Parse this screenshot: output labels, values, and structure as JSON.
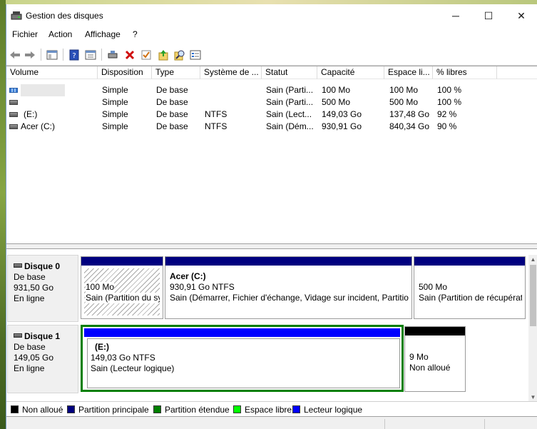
{
  "window": {
    "title": "Gestion des disques"
  },
  "titlebar": {
    "minimize": "─",
    "maximize": "☐",
    "close": "✕"
  },
  "menu": [
    "Fichier",
    "Action",
    "Affichage",
    "?"
  ],
  "toolbar": {
    "icons": [
      "back-icon",
      "forward-icon",
      "console-tree-icon",
      "help-icon",
      "properties-icon",
      "connect-icon",
      "delete-icon",
      "check-icon",
      "import-icon",
      "search-icon",
      "details-icon"
    ]
  },
  "volume_list": {
    "columns": [
      "Volume",
      "Disposition",
      "Type",
      "Système de ...",
      "Statut",
      "Capacité",
      "Espace li...",
      "% libres"
    ],
    "rows": [
      {
        "volume": "",
        "icon": "blue",
        "disposition": "Simple",
        "type": "De base",
        "fs": "",
        "status": "Sain (Parti...",
        "capacity": "100 Mo",
        "free": "100 Mo",
        "pct": "100 %"
      },
      {
        "volume": "",
        "icon": "gray",
        "disposition": "Simple",
        "type": "De base",
        "fs": "",
        "status": "Sain (Parti...",
        "capacity": "500 Mo",
        "free": "500 Mo",
        "pct": "100 %"
      },
      {
        "volume": "(E:)",
        "icon": "gray",
        "disposition": "Simple",
        "type": "De base",
        "fs": "NTFS",
        "status": "Sain (Lect...",
        "capacity": "149,03 Go",
        "free": "137,48 Go",
        "pct": "92 %"
      },
      {
        "volume": "Acer (C:)",
        "icon": "gray",
        "disposition": "Simple",
        "type": "De base",
        "fs": "NTFS",
        "status": "Sain (Dém...",
        "capacity": "930,91 Go",
        "free": "840,34 Go",
        "pct": "90 %"
      }
    ]
  },
  "disks": [
    {
      "name": "Disque 0",
      "kind": "De base",
      "size": "931,50 Go",
      "state": "En ligne",
      "partitions": [
        {
          "title": "",
          "line1": "100 Mo",
          "line2": "Sain (Partition du système EFI)",
          "bar_color": "#00007f",
          "hatched": true
        },
        {
          "title": "Acer  (C:)",
          "line1": "930,91 Go NTFS",
          "line2": "Sain (Démarrer, Fichier d'échange, Vidage sur incident, Partition principale)",
          "bar_color": "#00007f",
          "hatched": false
        },
        {
          "title": "",
          "line1": "500 Mo",
          "line2": "Sain (Partition de récupération)",
          "bar_color": "#00007f",
          "hatched": false
        }
      ]
    },
    {
      "name": "Disque 1",
      "kind": "De base",
      "size": "149,05 Go",
      "state": "En ligne",
      "partitions": [
        {
          "title": "(E:)",
          "line1": "149,03 Go NTFS",
          "line2": "Sain (Lecteur logique)",
          "bar_color": "#0000ff",
          "hatched": false
        },
        {
          "title": "",
          "line1": "9 Mo",
          "line2": "Non alloué",
          "bar_color": "#000000",
          "hatched": false
        }
      ]
    }
  ],
  "legend": [
    {
      "label": "Non alloué",
      "color": "#000000"
    },
    {
      "label": "Partition principale",
      "color": "#00007f"
    },
    {
      "label": "Partition étendue",
      "color": "#007f00"
    },
    {
      "label": "Espace libre",
      "color": "#00ff00"
    },
    {
      "label": "Lecteur logique",
      "color": "#0000ff"
    }
  ]
}
